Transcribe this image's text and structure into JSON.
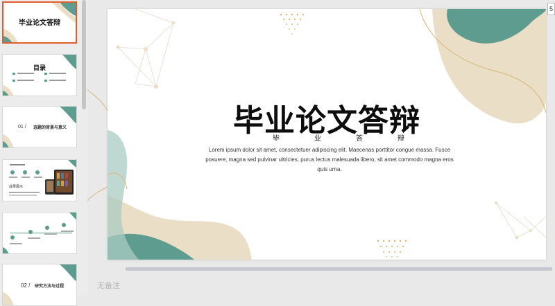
{
  "thumbnails": [
    {
      "title": "毕业论文答辩",
      "selected": true
    },
    {
      "title": "目录"
    },
    {
      "section": "01",
      "heading": "选题的背景与意义"
    },
    {
      "heading": "成果展示"
    },
    {
      "heading": ""
    },
    {
      "section": "02",
      "heading": "研究方法与过程"
    }
  ],
  "slide": {
    "title": "毕业论文答辩",
    "subtitle_chars": [
      "毕",
      "业",
      "答",
      "辩"
    ],
    "body": "Lorem ipsum dolor sit amet, consectetuer adipiscing elit. Maecenas porttitor congue massa. Fusce posuere, magna sed pulvinar ultricies, purus lectus malesuada libero, sit amet commodo magna eros quis urna.",
    "colors": {
      "teal": "#5e9c8f",
      "sand": "#eadfc6",
      "gold": "#d9b579"
    }
  },
  "notes_placeholder": "无备注",
  "right_edge_glyph": "5"
}
